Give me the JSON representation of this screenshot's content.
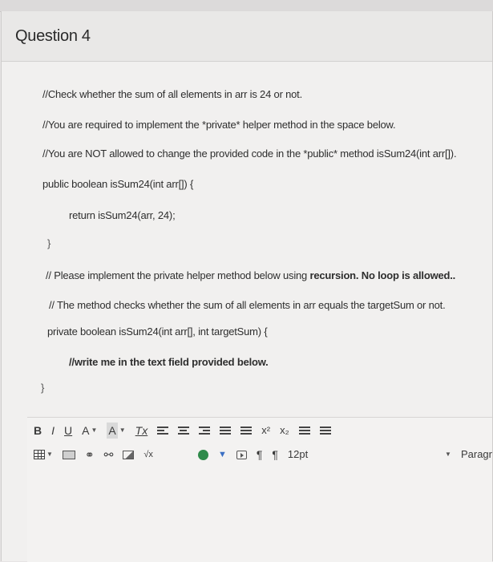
{
  "question": {
    "title": "Question 4"
  },
  "code_lines": [
    "//Check whether the sum of all elements in arr is 24 or not.",
    "//You are required to implement the *private* helper method in the space below.",
    "//You are NOT allowed to change the provided code in the *public* method isSum24(int arr[]).",
    "public boolean isSum24(int arr[])   {",
    "return isSum24(arr, 24);",
    "}",
    "// Please implement the private helper method below using ",
    "recursion. No loop is allowed..",
    "// The method checks whether the sum of all elements in arr equals the targetSum or not.",
    "private boolean isSum24(int arr[], int targetSum) {",
    "//write me in the text field provided below.",
    "}"
  ],
  "toolbar": {
    "bold": "B",
    "italic": "I",
    "underline": "U",
    "font_color": "A",
    "bg_color": "A",
    "clear_format": "Tx",
    "superscript": "x²",
    "subscript": "x₂",
    "font_size": "12pt",
    "paragraph": "Paragr",
    "equation": "√x",
    "ltr": "¶",
    "rtl": "¶"
  },
  "icons": {
    "text_color": "#3b6fc4",
    "green_app": "#2f8a4a"
  }
}
